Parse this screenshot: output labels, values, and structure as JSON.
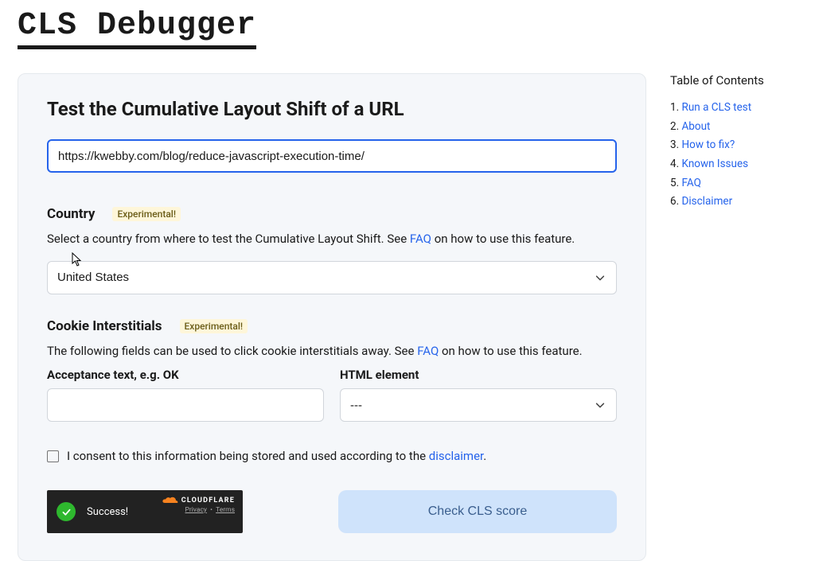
{
  "header": {
    "title": "CLS Debugger"
  },
  "card": {
    "heading": "Test the Cumulative Layout Shift of a URL",
    "url_value": "https://kwebby.com/blog/reduce-javascript-execution-time/",
    "country": {
      "label": "Country",
      "badge": "Experimental!",
      "help_pre": "Select a country from where to test the Cumulative Layout Shift. See ",
      "help_link": "FAQ",
      "help_post": " on how to use this feature.",
      "value": "United States"
    },
    "cookie": {
      "label": "Cookie Interstitials",
      "badge": "Experimental!",
      "help_pre": "The following fields can be used to click cookie interstitials away. See ",
      "help_link": "FAQ",
      "help_post": " on how to use this feature.",
      "acceptance_label": "Acceptance text, e.g. OK",
      "acceptance_value": "",
      "element_label": "HTML element",
      "element_value": "---"
    },
    "consent": {
      "text_pre": "I consent to this information being stored and used according to the ",
      "link": "disclaimer",
      "text_post": "."
    },
    "captcha": {
      "status": "Success!",
      "brand": "CLOUDFLARE",
      "privacy": "Privacy",
      "terms": "Terms"
    },
    "submit_label": "Check CLS score"
  },
  "toc": {
    "title": "Table of Contents",
    "items": [
      "Run a CLS test",
      "About",
      "How to fix?",
      "Known Issues",
      "FAQ",
      "Disclaimer"
    ]
  }
}
